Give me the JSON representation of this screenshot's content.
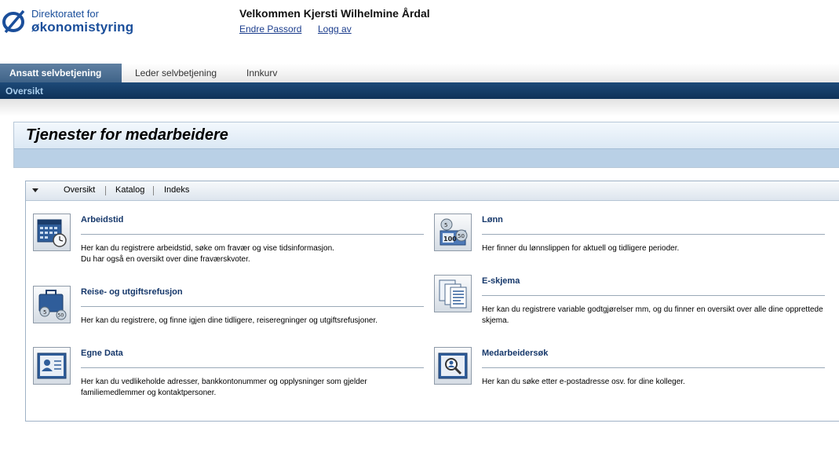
{
  "header": {
    "logo_line1": "Direktoratet for",
    "logo_line2": "økonomistyring",
    "welcome": "Velkommen Kjersti Wilhelmine Årdal",
    "change_password": "Endre Passord",
    "logout": "Logg av"
  },
  "nav": {
    "tabs": [
      {
        "label": "Ansatt selvbetjening",
        "active": true
      },
      {
        "label": "Leder selvbetjening",
        "active": false
      },
      {
        "label": "Innkurv",
        "active": false
      }
    ],
    "subnav": "Oversikt"
  },
  "page": {
    "title": "Tjenester for medarbeidere"
  },
  "toolbar": {
    "items": [
      "Oversikt",
      "Katalog",
      "Indeks"
    ]
  },
  "services": [
    {
      "icon": "calendar-clock-icon",
      "title": "Arbeidstid",
      "desc1": "Her kan du registrere arbeidstid, søke om fravær og vise tidsinformasjon.",
      "desc2": "Du har også en oversikt over dine fraværskvoter."
    },
    {
      "icon": "money-icon",
      "title": "Lønn",
      "desc1": "Her finner du lønnslippen for aktuell og tidligere perioder.",
      "desc2": ""
    },
    {
      "icon": "suitcase-coins-icon",
      "title": "Reise- og utgiftsrefusjon",
      "desc1": "Her kan du registrere, og finne igjen dine tidligere, reiseregninger og utgiftsrefusjoner.",
      "desc2": ""
    },
    {
      "icon": "forms-icon",
      "title": "E-skjema",
      "desc1": "Her kan du registrere variable godtgjørelser mm, og du finner en oversikt over alle dine opprettede skjema.",
      "desc2": ""
    },
    {
      "icon": "id-card-icon",
      "title": "Egne Data",
      "desc1": "Her kan du vedlikeholde adresser, bankkontonummer og opplysninger som gjelder familiemedlemmer og kontaktpersoner.",
      "desc2": ""
    },
    {
      "icon": "person-search-icon",
      "title": "Medarbeidersøk",
      "desc1": "Her kan du søke etter e-postadresse osv. for dine kolleger.",
      "desc2": ""
    }
  ],
  "colors": {
    "brand": "#1b4f9b",
    "tab_active": "#4b6f94",
    "subnav": "#163f6b",
    "link": "#1a3c8c",
    "service_title": "#15376a"
  }
}
